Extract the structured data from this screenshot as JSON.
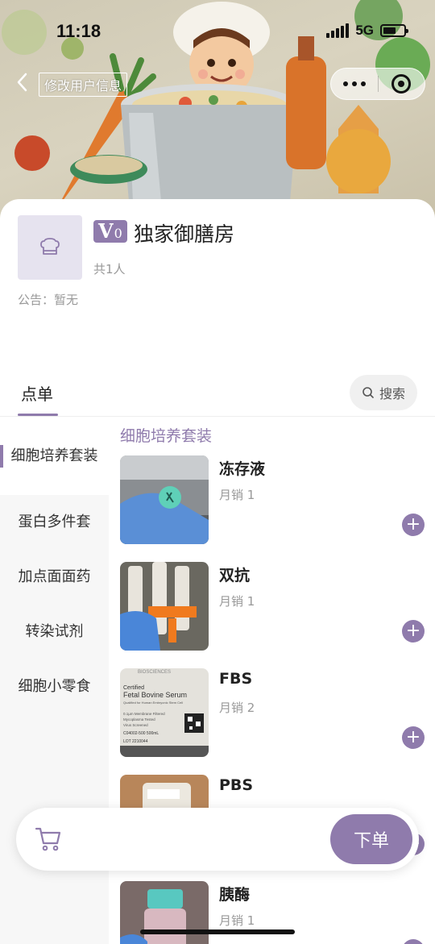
{
  "status_bar": {
    "time": "11:18",
    "network": "5G"
  },
  "nav": {
    "title": "修改用户信息"
  },
  "shop": {
    "vip_letter": "V",
    "vip_level": "0",
    "name": "独家御膳房",
    "members": "共1人",
    "notice": "公告：暂无"
  },
  "tabs": {
    "order": "点单",
    "search": "搜索"
  },
  "categories": [
    {
      "label": "细胞培养套装",
      "active": true
    },
    {
      "label": "蛋白多件套",
      "active": false
    },
    {
      "label": "加点面面药",
      "active": false
    },
    {
      "label": "转染试剂",
      "active": false
    },
    {
      "label": "细胞小零食",
      "active": false
    }
  ],
  "section_title": "细胞培养套装",
  "products": [
    {
      "name": "冻存液",
      "sales": "月销 1"
    },
    {
      "name": "双抗",
      "sales": "月销 1"
    },
    {
      "name": "FBS",
      "sales": "月销 2",
      "photo_text": [
        "BIOSCIENCES",
        "Certified",
        "Fetal Bovine Serum",
        "Qualified for Human Embryonic Stem Cell",
        "0.1µm Membrane Filtered",
        "Mycoplasma Tested",
        "Virus Screened",
        "C04002-500   500mL",
        "LOT 2210044"
      ]
    },
    {
      "name": "PBS",
      "sales": ""
    },
    {
      "name": "胰酶",
      "sales": "月销 1"
    }
  ],
  "cart": {
    "order_label": "下单"
  },
  "colors": {
    "accent": "#8f7bac"
  },
  "icons": [
    "back-icon",
    "more-icon",
    "close-circle-icon",
    "shop-logo-icon",
    "search-icon",
    "plus-icon",
    "cart-icon"
  ]
}
